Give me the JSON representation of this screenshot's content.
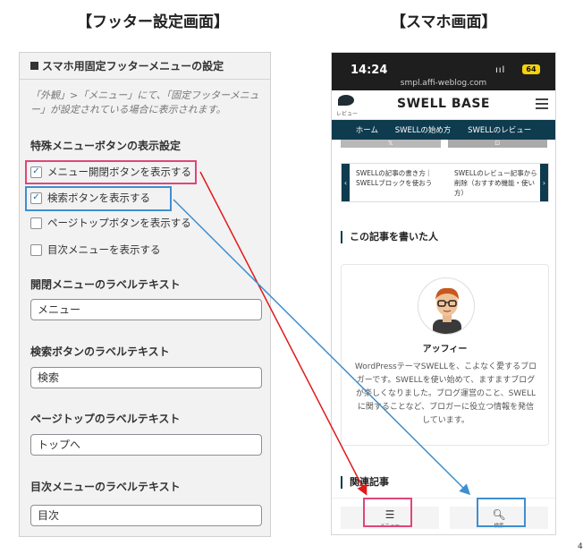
{
  "headings": {
    "left": "【フッター設定画面】",
    "right": "【スマホ画面】"
  },
  "settings": {
    "section_title": "スマホ用固定フッターメニューの設定",
    "note": "「外観」>「メニュー」にて、「固定フッターメニュー」が設定されている場合に表示されます。",
    "special_buttons_title": "特殊メニューボタンの表示設定",
    "checkboxes": [
      {
        "label": "メニュー開閉ボタンを表示する",
        "checked": true
      },
      {
        "label": "検索ボタンを表示する",
        "checked": true
      },
      {
        "label": "ページトップボタンを表示する",
        "checked": false
      },
      {
        "label": "目次メニューを表示する",
        "checked": false
      }
    ],
    "check_glyph": "✓",
    "fields": [
      {
        "label": "開閉メニューのラベルテキスト",
        "value": "メニュー"
      },
      {
        "label": "検索ボタンのラベルテキスト",
        "value": "検索"
      },
      {
        "label": "ページトップのラベルテキスト",
        "value": "トップへ"
      },
      {
        "label": "目次メニューのラベルテキスト",
        "value": "目次"
      }
    ]
  },
  "phone": {
    "time": "14:24",
    "signal": "ııl",
    "battery": "64",
    "url": "smpl.affi-weblog.com",
    "logo_caption": "レビュー",
    "site_title": "SWELL BASE",
    "nav": [
      "ホーム",
      "SWELLの始め方",
      "SWELLのレビュー"
    ],
    "share": [
      "𝕏",
      "⊡"
    ],
    "related": [
      "SWELLの記事の書き方｜SWELLブロックを使おう",
      "SWELLのレビュー記事から削除（おすすめ機能・使い方）"
    ],
    "author_heading": "この記事を書いた人",
    "author_name": "アッフィー",
    "bio": "WordPressテーマSWELLを、こよなく愛するブロガーです。SWELLを使い始めて、ますますブログが楽しくなりました。ブログ運営のこと、SWELLに関することなど、ブロガーに役立つ情報を発信しています。",
    "related_heading": "関連記事",
    "footer_menu": [
      {
        "icon": "☰",
        "label": "メニュー"
      },
      {
        "icon": "🔍︎",
        "label": "検索"
      }
    ]
  },
  "colors": {
    "highlight_pink": "#e0457b",
    "highlight_blue": "#3d8fd1",
    "arrow_red": "#e01a1a",
    "arrow_blue": "#3d8fd1",
    "nav_dark": "#0f3b4f"
  },
  "edge_mark": "4"
}
